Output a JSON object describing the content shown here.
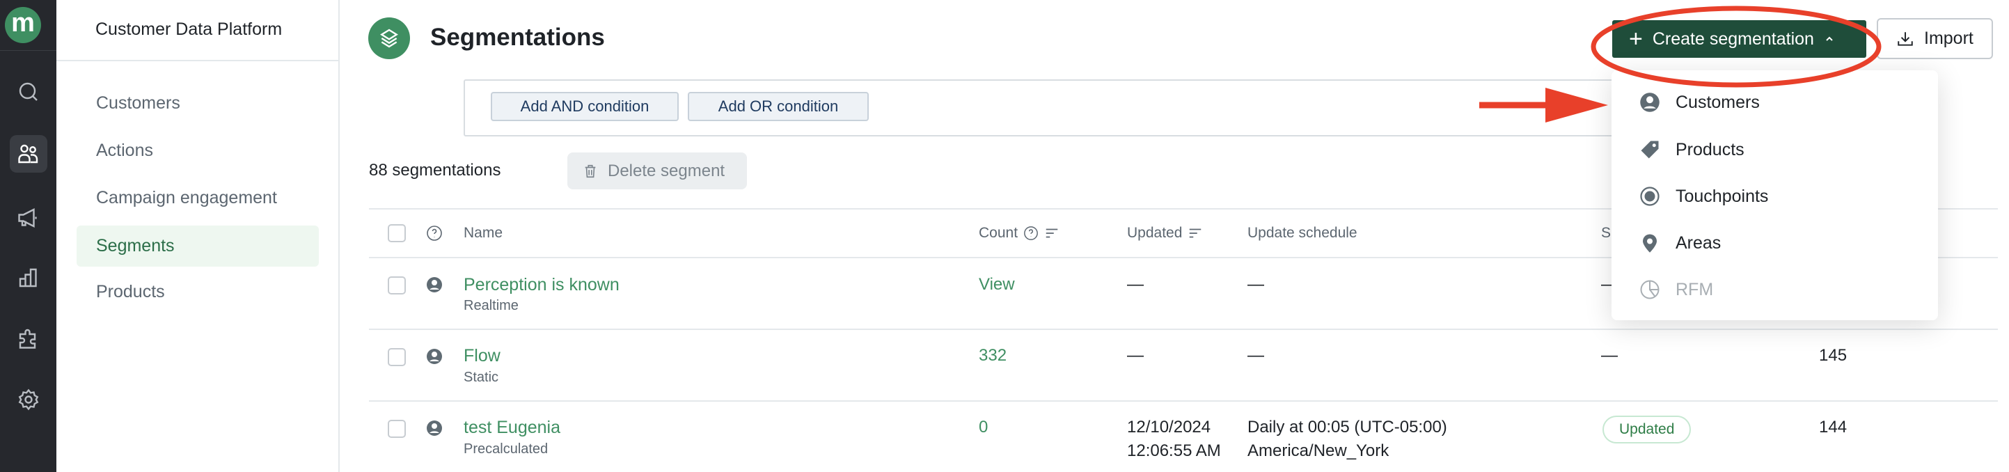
{
  "rail": {
    "logo": "m",
    "icons": [
      "search-icon",
      "users-icon",
      "megaphone-icon",
      "chart-icon",
      "puzzle-icon",
      "gear-icon"
    ],
    "active": "users-icon"
  },
  "sidebar": {
    "title": "Customer Data Platform",
    "items": [
      {
        "label": "Customers"
      },
      {
        "label": "Actions"
      },
      {
        "label": "Campaign engagement"
      },
      {
        "label": "Segments",
        "active": true
      },
      {
        "label": "Products"
      }
    ]
  },
  "header": {
    "title": "Segmentations",
    "create_label": "Create segmentation",
    "import_label": "Import"
  },
  "conditions": {
    "and_label": "Add AND condition",
    "or_label": "Add OR condition"
  },
  "toolbar": {
    "count": "88 segmentations",
    "delete_label": "Delete segment"
  },
  "table": {
    "columns": {
      "name": "Name",
      "count": "Count",
      "updated": "Updated",
      "schedule": "Update schedule",
      "status": "S"
    },
    "rows": [
      {
        "name": "Perception is known",
        "type": "Realtime",
        "count": "View",
        "updated": "—",
        "updated2": "",
        "schedule": "—",
        "schedule2": "",
        "status": "—",
        "last": ""
      },
      {
        "name": "Flow",
        "type": "Static",
        "count": "332",
        "updated": "—",
        "updated2": "",
        "schedule": "—",
        "schedule2": "",
        "status": "—",
        "last": "145"
      },
      {
        "name": "test Eugenia",
        "type": "Precalculated",
        "count": "0",
        "updated": "12/10/2024",
        "updated2": "12:06:55 AM",
        "schedule": "Daily at 00:05 (UTC-05:00)",
        "schedule2": "America/New_York",
        "status": "Updated",
        "last": "144"
      }
    ]
  },
  "dropdown": {
    "items": [
      {
        "label": "Customers",
        "icon": "user-circle-icon"
      },
      {
        "label": "Products",
        "icon": "tag-icon"
      },
      {
        "label": "Touchpoints",
        "icon": "radio-icon"
      },
      {
        "label": "Areas",
        "icon": "map-pin-icon"
      },
      {
        "label": "RFM",
        "icon": "pie-chart-icon",
        "disabled": true
      }
    ]
  },
  "colors": {
    "brand": "#3f8f62",
    "primary_button": "#1f4d3a",
    "rail": "#26282d",
    "annotation": "#e8402a"
  }
}
